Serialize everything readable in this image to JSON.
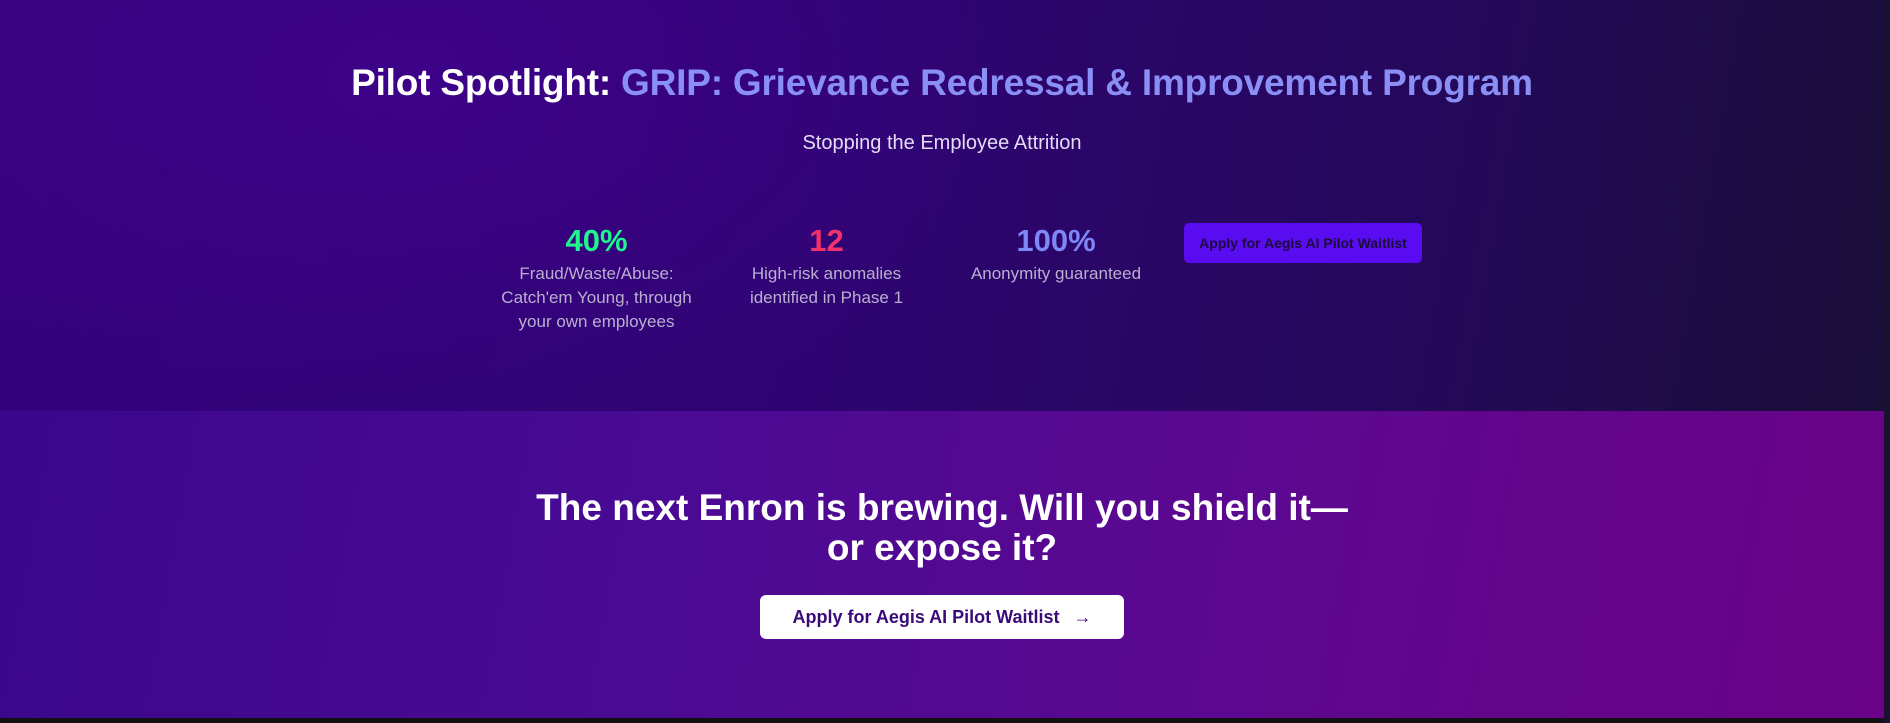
{
  "spotlight": {
    "title_prefix": "Pilot Spotlight: ",
    "title_accent": "GRIP: Grievance Redressal & Improvement Program",
    "subtitle": "Stopping the Employee Attrition",
    "stats": [
      {
        "value": "40%",
        "label": "Fraud/Waste/Abuse: Catch'em Young, through your own employees"
      },
      {
        "value": "12",
        "label": "High-risk anomalies identified in Phase 1"
      },
      {
        "value": "100%",
        "label": "Anonymity guaranteed"
      }
    ],
    "button_label": "Apply for Aegis AI Pilot Waitlist"
  },
  "cta": {
    "title": "The next Enron is brewing. Will you shield it—or expose it?",
    "button_label": "Apply for Aegis AI Pilot Waitlist",
    "button_icon": "arrow-right-icon"
  },
  "colors": {
    "stat_green": "#1ff58e",
    "stat_red": "#f0336c",
    "stat_blue": "#7f86f5",
    "accent_purple": "#5a0cf0"
  }
}
